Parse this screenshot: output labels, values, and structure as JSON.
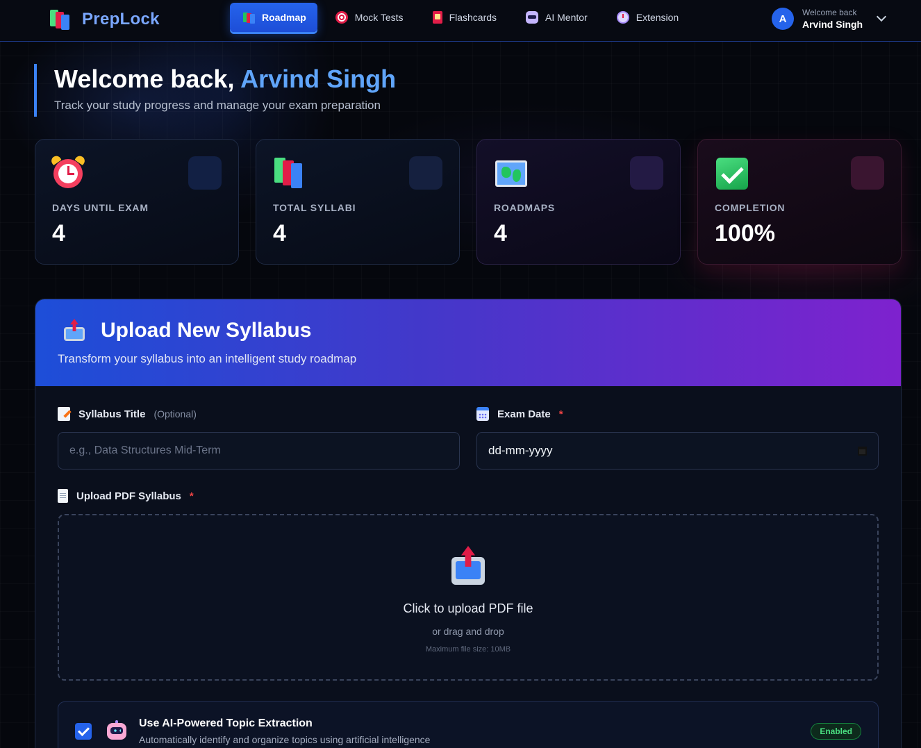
{
  "app": {
    "name": "PrepLock"
  },
  "nav": {
    "tabs": [
      {
        "label": "Roadmap",
        "icon": "roadmap-icon",
        "active": true
      },
      {
        "label": "Mock Tests",
        "icon": "target-icon",
        "active": false
      },
      {
        "label": "Flashcards",
        "icon": "flashcards-icon",
        "active": false
      },
      {
        "label": "AI Mentor",
        "icon": "robot-icon",
        "active": false
      },
      {
        "label": "Extension",
        "icon": "stopwatch-icon",
        "active": false
      }
    ]
  },
  "user": {
    "avatar_letter": "A",
    "welcome": "Welcome back",
    "name": "Arvind Singh"
  },
  "header": {
    "title_prefix": "Welcome back, ",
    "title_name": "Arvind Singh",
    "subtitle": "Track your study progress and manage your exam preparation"
  },
  "stats": [
    {
      "label": "DAYS UNTIL EXAM",
      "value": "4",
      "icon": "alarm-clock-icon"
    },
    {
      "label": "TOTAL SYLLABI",
      "value": "4",
      "icon": "books-icon"
    },
    {
      "label": "ROADMAPS",
      "value": "4",
      "icon": "world-map-icon"
    },
    {
      "label": "COMPLETION",
      "value": "100%",
      "icon": "check-mark-icon"
    }
  ],
  "upload": {
    "title": "Upload New Syllabus",
    "subtitle": "Transform your syllabus into an intelligent study roadmap",
    "title_field": {
      "label": "Syllabus Title",
      "optional": "(Optional)",
      "placeholder": "e.g., Data Structures Mid-Term",
      "value": ""
    },
    "date_field": {
      "label": "Exam Date",
      "required_mark": "*",
      "value": "dd-mm-yyyy"
    },
    "pdf_field": {
      "label": "Upload PDF Syllabus",
      "required_mark": "*"
    },
    "dropzone": {
      "title": "Click to upload PDF file",
      "subtitle": "or drag and drop",
      "max_size": "Maximum file size: 10MB"
    },
    "ai_option": {
      "title": "Use AI-Powered Topic Extraction",
      "description": "Automatically identify and organize topics using artificial intelligence",
      "checked": true,
      "badge": "Enabled"
    }
  },
  "colors": {
    "accent": "#2563eb",
    "highlight": "#60a5fa",
    "background": "#05070d",
    "badge_green": "#4ade80",
    "required": "#ef4444"
  }
}
